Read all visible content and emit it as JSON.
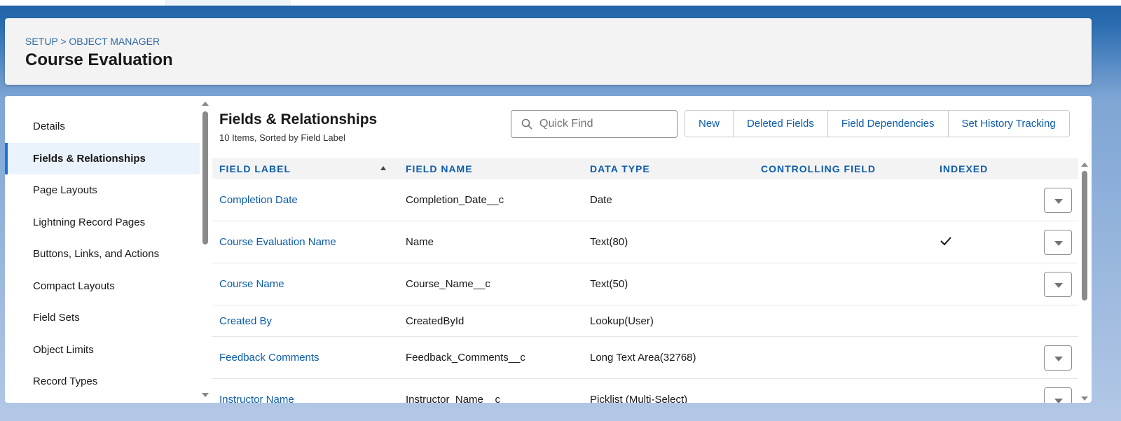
{
  "header": {
    "breadcrumb_setup": "SETUP",
    "breadcrumb_sep": ">",
    "breadcrumb_object_manager": "OBJECT MANAGER",
    "title": "Course Evaluation"
  },
  "sidebar": {
    "items": [
      {
        "label": "Details"
      },
      {
        "label": "Fields & Relationships",
        "active": true
      },
      {
        "label": "Page Layouts"
      },
      {
        "label": "Lightning Record Pages"
      },
      {
        "label": "Buttons, Links, and Actions"
      },
      {
        "label": "Compact Layouts"
      },
      {
        "label": "Field Sets"
      },
      {
        "label": "Object Limits"
      },
      {
        "label": "Record Types"
      }
    ]
  },
  "panel": {
    "title": "Fields & Relationships",
    "subtitle": "10 Items, Sorted by Field Label",
    "quick_find_placeholder": "Quick Find",
    "buttons": [
      "New",
      "Deleted Fields",
      "Field Dependencies",
      "Set History Tracking"
    ]
  },
  "table": {
    "columns": [
      "FIELD LABEL",
      "FIELD NAME",
      "DATA TYPE",
      "CONTROLLING FIELD",
      "INDEXED"
    ],
    "sort_icon": "arrow-up-icon",
    "rows": [
      {
        "label": "Completion Date",
        "name": "Completion_Date__c",
        "type": "Date",
        "controlling": "",
        "indexed": false,
        "action": true
      },
      {
        "label": "Course Evaluation Name",
        "name": "Name",
        "type": "Text(80)",
        "controlling": "",
        "indexed": true,
        "action": true
      },
      {
        "label": "Course Name",
        "name": "Course_Name__c",
        "type": "Text(50)",
        "controlling": "",
        "indexed": false,
        "action": true
      },
      {
        "label": "Created By",
        "name": "CreatedById",
        "type": "Lookup(User)",
        "controlling": "",
        "indexed": false,
        "action": false
      },
      {
        "label": "Feedback Comments",
        "name": "Feedback_Comments__c",
        "type": "Long Text Area(32768)",
        "controlling": "",
        "indexed": false,
        "action": true
      },
      {
        "label": "Instructor Name",
        "name": "Instructor_Name__c",
        "type": "Picklist (Multi-Select)",
        "controlling": "",
        "indexed": false,
        "action": true
      }
    ]
  },
  "colors": {
    "link": "#0b5cab",
    "active_bg": "#eaf2fb",
    "accent": "#1b72d6"
  }
}
